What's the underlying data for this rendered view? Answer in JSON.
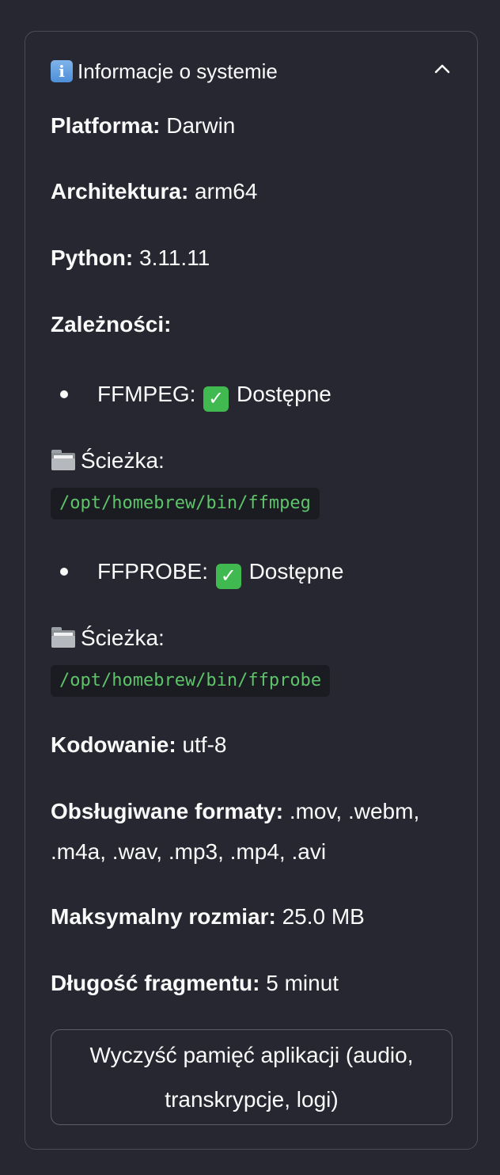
{
  "expander": {
    "title": "Informacje o systemie",
    "icon": "info-icon",
    "expanded": true
  },
  "system": {
    "platform": {
      "label": "Platforma:",
      "value": "Darwin"
    },
    "architecture": {
      "label": "Architektura:",
      "value": "arm64"
    },
    "python": {
      "label": "Python:",
      "value": "3.11.11"
    },
    "dependencies_label": "Zależności:"
  },
  "dependencies": [
    {
      "name": "FFMPEG:",
      "status": "Dostępne",
      "status_icon": "check-mark-icon",
      "path_label": "Ścieżka:",
      "path_icon": "folder-icon",
      "path": "/opt/homebrew/bin/ffmpeg"
    },
    {
      "name": "FFPROBE:",
      "status": "Dostępne",
      "status_icon": "check-mark-icon",
      "path_label": "Ścieżka:",
      "path_icon": "folder-icon",
      "path": "/opt/homebrew/bin/ffprobe"
    }
  ],
  "details": {
    "encoding": {
      "label": "Kodowanie:",
      "value": "utf-8"
    },
    "formats": {
      "label": "Obsługiwane formaty:",
      "value_line1": ".mov, .webm,",
      "value_line2": ".m4a, .wav, .mp3, .mp4, .avi"
    },
    "max_size": {
      "label": "Maksymalny rozmiar:",
      "value": "25.0 MB"
    },
    "chunk_length": {
      "label": "Długość fragmentu:",
      "value": "5 minut"
    }
  },
  "clear_button": {
    "line1": "Wyczyść pamięć aplikacji (audio,",
    "line2": "transkrypcje, logi)"
  },
  "colors": {
    "background": "#262730",
    "border": "#4a4c56",
    "code_text": "#5ec46a",
    "check": "#3fb950",
    "info_icon": "#4e8fd8"
  }
}
